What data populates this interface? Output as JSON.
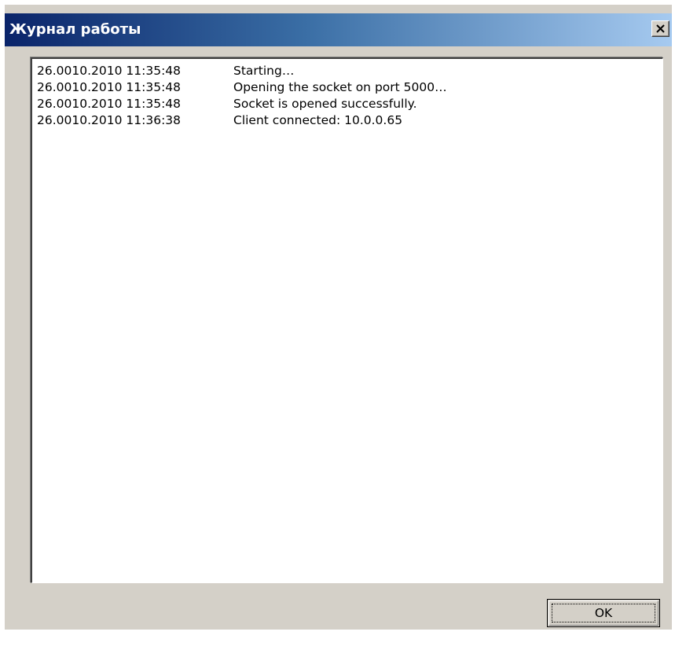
{
  "window": {
    "title": "Журнал работы",
    "close_icon": "close-icon"
  },
  "log": {
    "entries": [
      {
        "time": "26.0010.2010 11:35:48",
        "message": "Starting…"
      },
      {
        "time": "26.0010.2010 11:35:48",
        "message": "Opening the socket on port 5000…"
      },
      {
        "time": "26.0010.2010 11:35:48",
        "message": "Socket is opened successfully."
      },
      {
        "time": "26.0010.2010 11:36:38",
        "message": "Client connected: 10.0.0.65"
      }
    ]
  },
  "buttons": {
    "ok_label": "OK"
  },
  "colors": {
    "titlebar_start": "#0a246a",
    "titlebar_end": "#a6caf0",
    "window_face": "#d4d0c8",
    "log_background": "#ffffff"
  }
}
